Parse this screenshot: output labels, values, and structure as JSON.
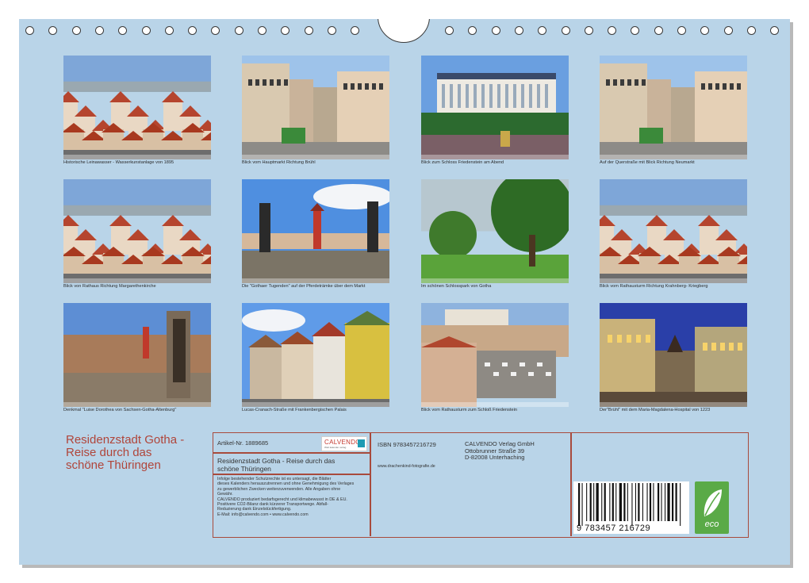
{
  "photos": [
    {
      "caption": "Historische Leinawasser - Wasserkunstanlage von 1895",
      "scene": "town-roofs"
    },
    {
      "caption": "Blick vom Hauptmarkt Richtung Brühl",
      "scene": "street"
    },
    {
      "caption": "Blick zum Schloss Friedenstein am Abend",
      "scene": "palace"
    },
    {
      "caption": "Auf der Querstraße mit Blick Richtung Neumarkt",
      "scene": "street"
    },
    {
      "caption": "Blick von Rathaus Richtung Margarethenkirche",
      "scene": "town-roofs"
    },
    {
      "caption": "Die \"Gothaer Tugenden\" auf der Pferdeträmke über dem Markt",
      "scene": "statues"
    },
    {
      "caption": "Im schönen Schlosspark von Gotha",
      "scene": "park"
    },
    {
      "caption": "Blick vom Rathausturm Richtung Krahnberg- Kriegberg",
      "scene": "town-roofs"
    },
    {
      "caption": "Denkmal \"Luise Dorothea von Sachsen-Gotha-Altenburg\"",
      "scene": "evening"
    },
    {
      "caption": "Lucas-Cranach-Straße mit Frankenbergischen Palais",
      "scene": "houses"
    },
    {
      "caption": "Blick vom Rathausturm zum Schloß Friedenstein",
      "scene": "square"
    },
    {
      "caption": "Der\"Brühl\" mit dem Maria-Magdalena-Hospital von 1223",
      "scene": "night"
    }
  ],
  "cover_title": [
    "Residenzstadt Gotha -",
    "Reise durch das",
    "schöne Thüringen"
  ],
  "info": {
    "article": "Artikel-Nr. 1889685",
    "publisher_logo": "CALVENDO",
    "publisher_logo_sub": "Welt kalender verlag",
    "product_title": [
      "Residenzstadt Gotha - Reise durch das",
      "schöne Thüringen"
    ],
    "legal": [
      "Infolge bestehender Schutzrechte ist es untersagt, die Blätter",
      "dieses Kalenders herauszutrennen und ohne Genehmigung des Verlages",
      "zu gewerblichen Zwecken weiterzuverwenden. Alle Angaben ohne",
      "Gewähr.",
      "CALVENDO produziert bedarfsgerecht und klimabewusst in DE & EU.",
      "Positivere CO2-Bilanz dank kürzerer Transportwege. Abfall-",
      "Reduzierung dank Einzelstückfertigung.",
      "E-Mail: info@calvendo.com • www.calvendo.com"
    ],
    "isbn": "ISBN 9783457216729",
    "url": "www.drachenkind-fotografie.de",
    "address": [
      "CALVENDO Verlag GmbH",
      "Ottobrunner Straße 39",
      "D-82008 Unterhaching"
    ],
    "barcode_digits": "9   783457   216729",
    "eco_label": "eco"
  },
  "colors": {
    "page": "#b9d4e8",
    "accent": "#b0453a",
    "eco": "#5aaa47"
  }
}
